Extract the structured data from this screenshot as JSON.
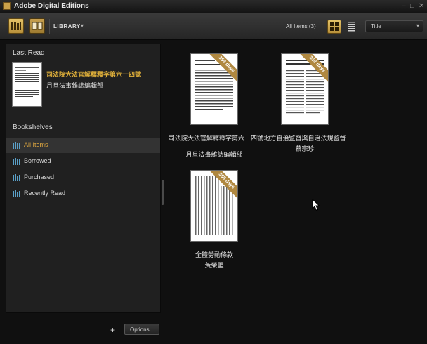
{
  "window": {
    "title": "Adobe Digital Editions",
    "controls": [
      "–",
      "□",
      "✕"
    ]
  },
  "toolbar": {
    "library_label": "LIBRARY",
    "library_caret": "▾",
    "count_label": "All Items  (3)",
    "sort": {
      "selected": "Title",
      "caret": "▾"
    }
  },
  "left_panel": {
    "last_read_title": "Last Read",
    "last_read": {
      "title": "司法院大法官解釋釋字第六一四號",
      "author": "月旦法事雜誌編輯部"
    },
    "bookshelves_title": "Bookshelves",
    "shelves": [
      {
        "label": "All Items",
        "selected": true
      },
      {
        "label": "Borrowed",
        "selected": false
      },
      {
        "label": "Purchased",
        "selected": false
      },
      {
        "label": "Recently Read",
        "selected": false
      }
    ]
  },
  "bottom_bar": {
    "add_label": "+",
    "options_label": "Options"
  },
  "books": [
    {
      "title": "司法院大法官解釋釋字第六一四號",
      "author": "月旦法事雜誌編輯部",
      "badge": "359 days"
    },
    {
      "title": "地方自治監督與自治法規監督",
      "author": "蔡宗珍",
      "badge": "359 days"
    },
    {
      "title": "全體勞動條款",
      "author": "黃榮堅",
      "badge": "359 days"
    }
  ],
  "colors": {
    "accent": "#e0a840",
    "ribbon": "#b08840",
    "panel": "#202020",
    "background": "#101010"
  },
  "icons": {
    "app": "adobe-de-icon",
    "library_view": "library-view-icon",
    "reading_view": "reading-view-icon",
    "grid_view": "grid-view-icon",
    "list_view": "list-view-icon",
    "bookshelf": "bookshelf-icon",
    "cursor": "mouse-pointer-icon"
  }
}
